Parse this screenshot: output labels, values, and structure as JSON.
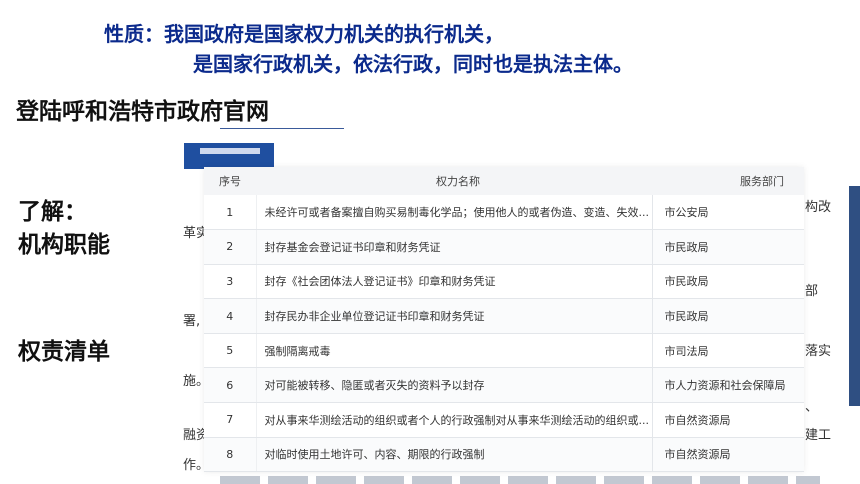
{
  "slide": {
    "title_line1": "性质：我国政府是国家权力机关的执行机关，",
    "title_line2": "是国家行政机关，依法行政，同时也是执法主体。",
    "site_heading": "登陆呼和浩特市政府官网",
    "label_know_line1": "了解：",
    "label_know_line2": "机构职能",
    "label_list": "权责清单"
  },
  "background_page": {
    "fragments": {
      "f1": "革实",
      "f2": "署,",
      "f3": "施。",
      "f4": "融资",
      "f5": "作。",
      "r1": "构改",
      "r2": "部",
      "r3": "落实",
      "r4": "、",
      "r5": "建工"
    }
  },
  "table": {
    "headers": {
      "no": "序号",
      "name": "权力名称",
      "dept": "服务部门"
    },
    "rows": [
      {
        "no": "1",
        "name": "未经许可或者备案擅自购买易制毒化学品；使用他人的或者伪造、变造、失效...",
        "dept": "市公安局"
      },
      {
        "no": "2",
        "name": "封存基金会登记证书印章和财务凭证",
        "dept": "市民政局"
      },
      {
        "no": "3",
        "name": "封存《社会团体法人登记证书》印章和财务凭证",
        "dept": "市民政局"
      },
      {
        "no": "4",
        "name": "封存民办非企业单位登记证书印章和财务凭证",
        "dept": "市民政局"
      },
      {
        "no": "5",
        "name": "强制隔离戒毒",
        "dept": "市司法局"
      },
      {
        "no": "6",
        "name": "对可能被转移、隐匿或者灭失的资料予以封存",
        "dept": "市人力资源和社会保障局"
      },
      {
        "no": "7",
        "name": "对从事来华测绘活动的组织或者个人的行政强制对从事来华测绘活动的组织或...",
        "dept": "市自然资源局"
      },
      {
        "no": "8",
        "name": "对临时使用土地许可、内容、期限的行政强制",
        "dept": "市自然资源局"
      }
    ]
  }
}
